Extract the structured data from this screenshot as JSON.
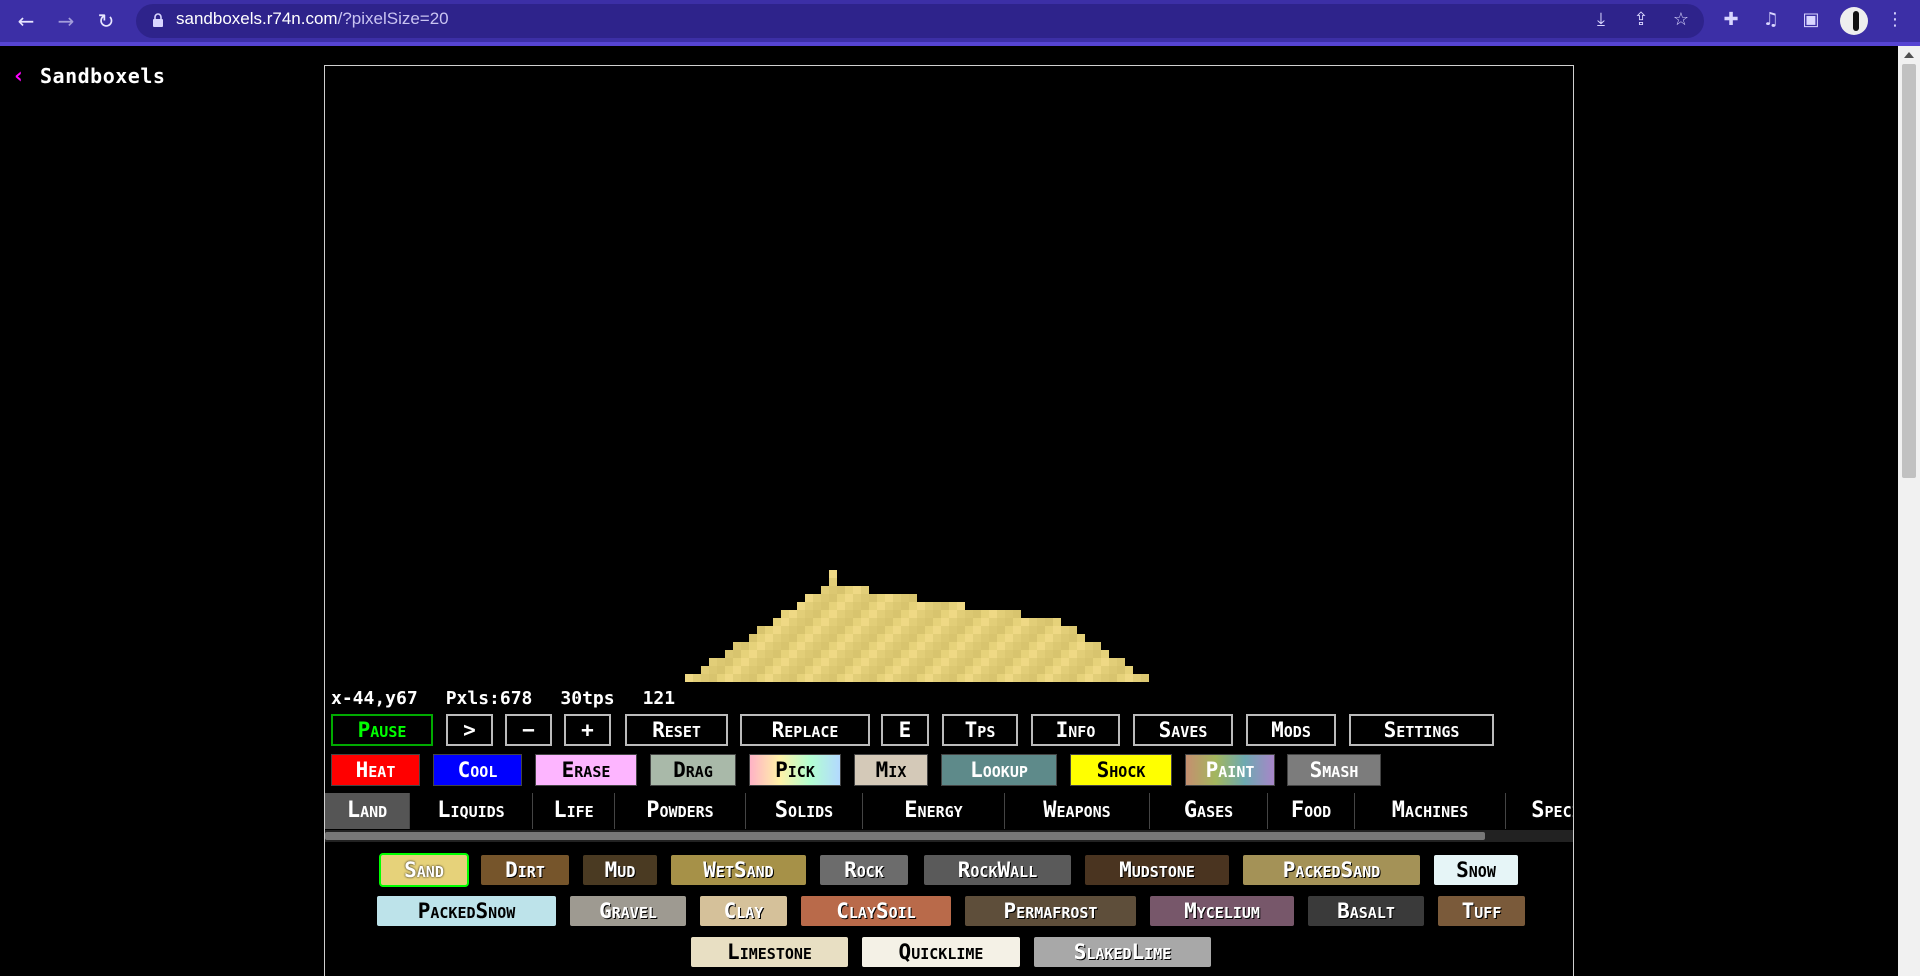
{
  "browser": {
    "url_host": "sandboxels.r74n.com",
    "url_path": "/?pixelSize=20",
    "icons": [
      "back-icon",
      "forward-icon",
      "reload-icon",
      "lock-icon",
      "install-icon",
      "share-icon",
      "star-icon",
      "extensions-icon",
      "media-icon",
      "sidebar-icon",
      "profile-icon",
      "menu-icon"
    ]
  },
  "header": {
    "back_glyph": "‹",
    "title": "Sandboxels"
  },
  "stats": {
    "coords": "x-44,y67",
    "pixels": "Pxls:678",
    "tps": "30tps",
    "tick": "121"
  },
  "controls": [
    "Pause",
    ">",
    "−",
    "+",
    "Reset",
    "Replace",
    "E",
    "Tps",
    "Info",
    "Saves",
    "Mods",
    "Settings"
  ],
  "tools": [
    {
      "label": "Heat",
      "bg": "#ff0000",
      "fg": "#ffffff"
    },
    {
      "label": "Cool",
      "bg": "#0000ff",
      "fg": "#ffffff"
    },
    {
      "label": "Erase",
      "bg": "#fdb5ff",
      "fg": "#000000"
    },
    {
      "label": "Drag",
      "bg": "#a9b9a9",
      "fg": "#000000"
    },
    {
      "label": "Pick",
      "bg": "gradient-pastel",
      "fg": "#000000"
    },
    {
      "label": "Mix",
      "bg": "#d4c9b8",
      "fg": "#000000"
    },
    {
      "label": "Lookup",
      "bg": "#5e8a8a",
      "fg": "#ffffff"
    },
    {
      "label": "Shock",
      "bg": "#ffff00",
      "fg": "#000000"
    },
    {
      "label": "Paint",
      "bg": "gradient-rainbow",
      "fg": "#ffffff"
    },
    {
      "label": "Smash",
      "bg": "#7c7c7c",
      "fg": "#ffffff"
    }
  ],
  "categories": [
    "Land",
    "Liquids",
    "Life",
    "Powders",
    "Solids",
    "Energy",
    "Weapons",
    "Gases",
    "Food",
    "Machines",
    "Special",
    "S"
  ],
  "active_category": "Land",
  "elements": [
    {
      "label": "Sand",
      "bg": "#e6d27a",
      "fg": "#ffffff",
      "selected": true
    },
    {
      "label": "Dirt",
      "bg": "#76552b",
      "fg": "#ffffff"
    },
    {
      "label": "Mud",
      "bg": "#4a3a22",
      "fg": "#ffffff"
    },
    {
      "label": "WetSand",
      "bg": "#a69148",
      "fg": "#ffffff"
    },
    {
      "label": "Rock",
      "bg": "#6c6c6c",
      "fg": "#ffffff"
    },
    {
      "label": "RockWall",
      "bg": "#5a5a5a",
      "fg": "#ffffff"
    },
    {
      "label": "Mudstone",
      "bg": "#4a3420",
      "fg": "#ffffff"
    },
    {
      "label": "PackedSand",
      "bg": "#a49257",
      "fg": "#ffffff"
    },
    {
      "label": "Snow",
      "bg": "#e6f5f7",
      "fg": "#000000"
    },
    {
      "label": "PackedSnow",
      "bg": "#bde3ea",
      "fg": "#000000"
    },
    {
      "label": "Gravel",
      "bg": "#9e9a91",
      "fg": "#ffffff"
    },
    {
      "label": "Clay",
      "bg": "#d5c19a",
      "fg": "#ffffff"
    },
    {
      "label": "ClaySoil",
      "bg": "#b96a4a",
      "fg": "#ffffff"
    },
    {
      "label": "Permafrost",
      "bg": "#5e4e3a",
      "fg": "#ffffff"
    },
    {
      "label": "Mycelium",
      "bg": "#77576a",
      "fg": "#ffffff"
    },
    {
      "label": "Basalt",
      "bg": "#3a3a3a",
      "fg": "#ffffff"
    },
    {
      "label": "Tuff",
      "bg": "#7a5a3a",
      "fg": "#ffffff"
    },
    {
      "label": "Limestone",
      "bg": "#e8dfc3",
      "fg": "#000000"
    },
    {
      "label": "Quicklime",
      "bg": "#f4f1e6",
      "fg": "#000000"
    },
    {
      "label": "SlakedLime",
      "bg": "#a8a8a8",
      "fg": "#ffffff"
    }
  ],
  "sand_color": "#e6d27a"
}
